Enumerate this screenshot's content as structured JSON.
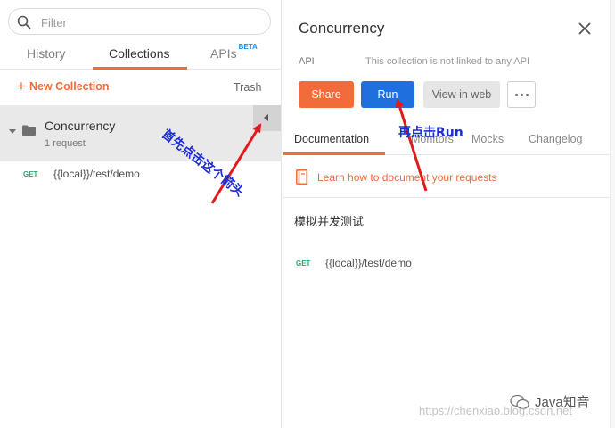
{
  "sidebar": {
    "search_placeholder": "Filter",
    "tabs": {
      "history": "History",
      "collections": "Collections",
      "apis": "APIs",
      "apis_badge": "BETA"
    },
    "new_collection_label": "New Collection",
    "trash_label": "Trash",
    "collection": {
      "name": "Concurrency",
      "count": "1 request"
    },
    "request": {
      "method": "GET",
      "url": "{{local}}/test/demo"
    }
  },
  "panel": {
    "title": "Concurrency",
    "api_label": "API",
    "api_note": "This collection is not linked to any API",
    "buttons": {
      "share": "Share",
      "run": "Run",
      "view_web": "View in web"
    },
    "tabs": {
      "documentation": "Documentation",
      "monitors": "Monitors",
      "mocks": "Mocks",
      "changelog": "Changelog"
    },
    "learn_link": "Learn how to document your requests",
    "description": "模拟并发测试",
    "request": {
      "method": "GET",
      "url": "{{local}}/test/demo"
    }
  },
  "annotations": {
    "first": "首先点击这个箭头",
    "second": "再点击Run"
  },
  "watermark": {
    "url": "https://chenxiao.blog.csdn.net",
    "brand": "Java知音"
  },
  "colors": {
    "accent_orange": "#f26b3a",
    "run_blue": "#1f6fde",
    "get_green": "#27a86b",
    "annotation_red": "#e01b1b",
    "annotation_text_blue": "#1a2bd8"
  }
}
